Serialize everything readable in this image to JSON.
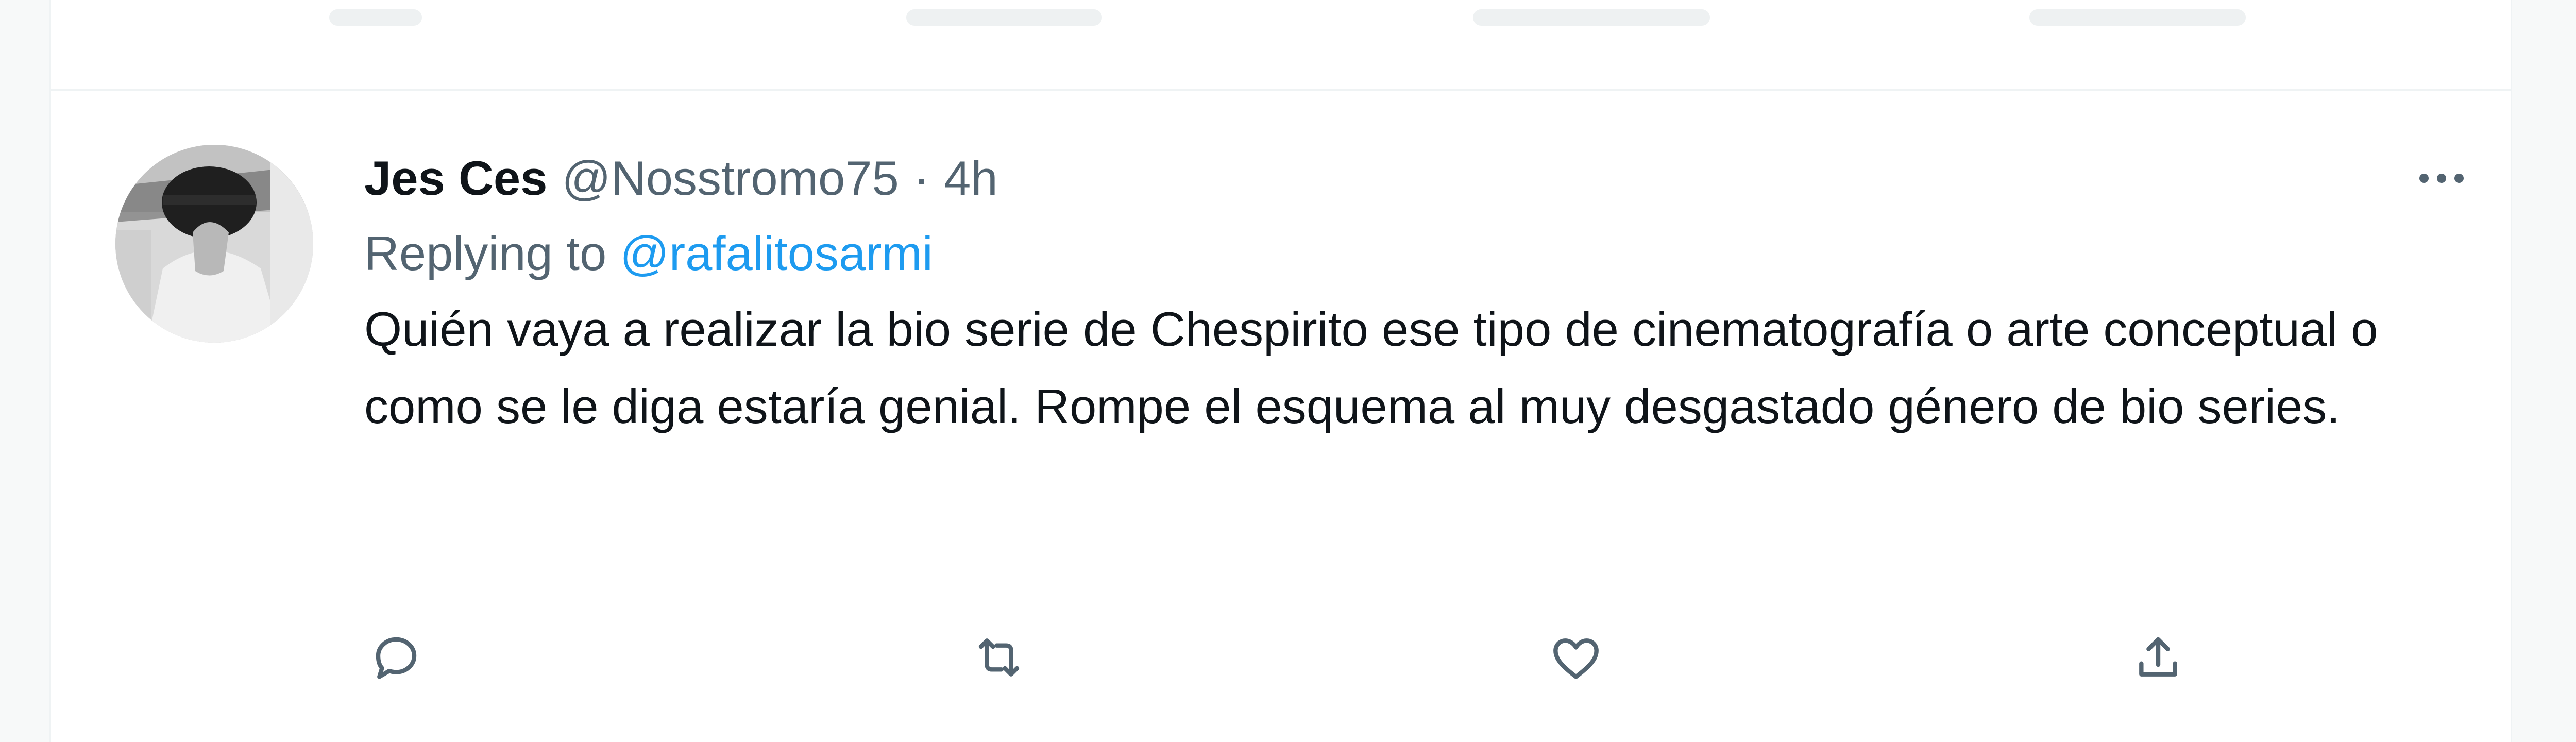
{
  "tweet": {
    "display_name": "Jes Ces",
    "handle": "@Nosstromo75",
    "separator": "·",
    "time": "4h",
    "replying_prefix": "Replying to",
    "replying_handle": "@rafalitosarmi",
    "text": "Quién vaya a realizar la bio serie de Chespirito ese tipo de cinematografía o arte conceptual o como se le diga estaría genial. Rompe el esquema al muy desgastado género de bio series."
  },
  "icons": {
    "more": "more-icon",
    "reply": "reply-icon",
    "retweet": "retweet-icon",
    "like": "like-icon",
    "share": "share-icon"
  },
  "colors": {
    "text": "#0f1419",
    "secondary": "#536471",
    "link": "#1d9bf0",
    "border": "#eff3f4",
    "background": "#f7f9f9"
  }
}
